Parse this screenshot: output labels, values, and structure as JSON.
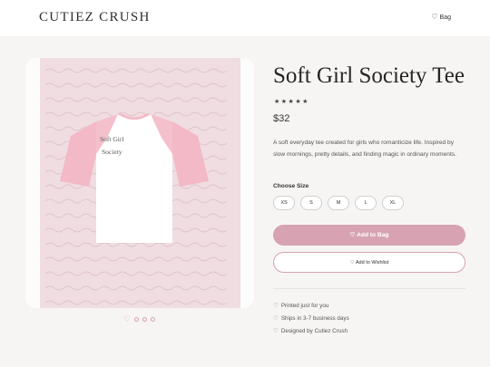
{
  "header": {
    "logo": "CUTIEZ CRUSH",
    "bag_label": "Bag",
    "bag_icon": "heart-icon"
  },
  "product": {
    "image_text_line1": "Soft Girl",
    "image_text_line2": "Society",
    "title": "Soft Girl Society Tee",
    "rating_stars": "★★★★★",
    "rating": 5,
    "price": "$32",
    "description": "A soft everyday tee created for girls who romanticize life. Inspired by slow mornings, pretty details, and finding magic in ordinary moments.",
    "size_label": "Choose Size",
    "sizes": [
      "XS",
      "S",
      "M",
      "L",
      "XL"
    ],
    "add_to_bag": "♡ Add to Bag",
    "add_to_wishlist": "♡ Add to Wishlist",
    "info": [
      "Printed just for you",
      "Ships in 3-7 business days",
      "Designed by Cutiez Crush"
    ],
    "info_icon": "♡",
    "gallery_heart": "♡"
  },
  "colors": {
    "accent": "#d7a3b2",
    "sleeve": "#f3b9c6",
    "background": "#f7f5f3",
    "paper": "#f0dde1"
  }
}
